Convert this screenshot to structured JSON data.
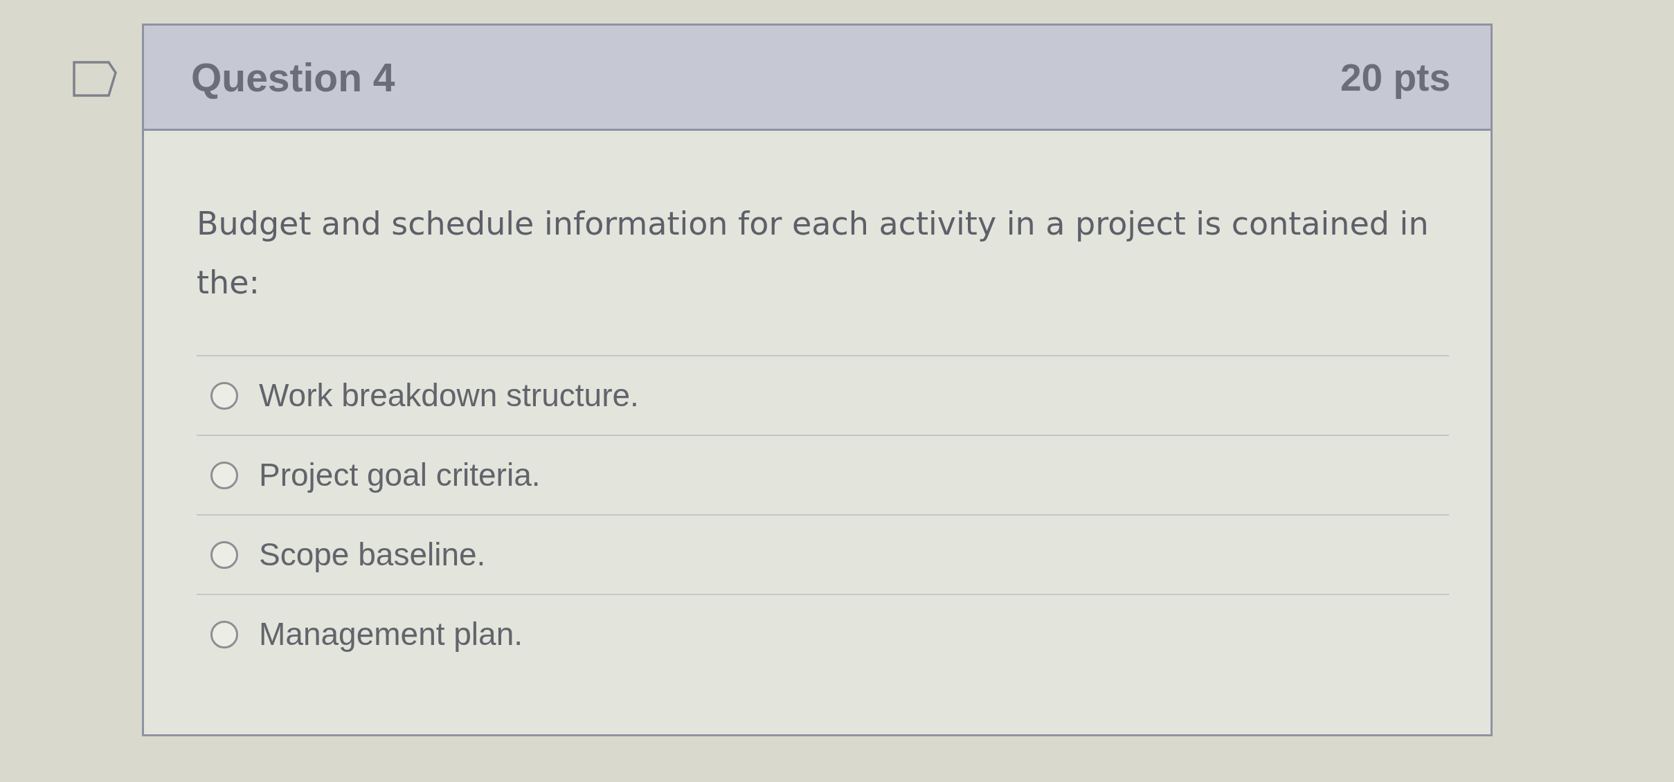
{
  "question": {
    "flagged": false,
    "title": "Question 4",
    "points": "20 pts",
    "text": "Budget and schedule information for each activity in a project is contained in the:",
    "answers": [
      {
        "label": "Work breakdown structure.",
        "selected": false
      },
      {
        "label": "Project goal criteria.",
        "selected": false
      },
      {
        "label": "Scope baseline.",
        "selected": false
      },
      {
        "label": "Management plan.",
        "selected": false
      }
    ]
  }
}
